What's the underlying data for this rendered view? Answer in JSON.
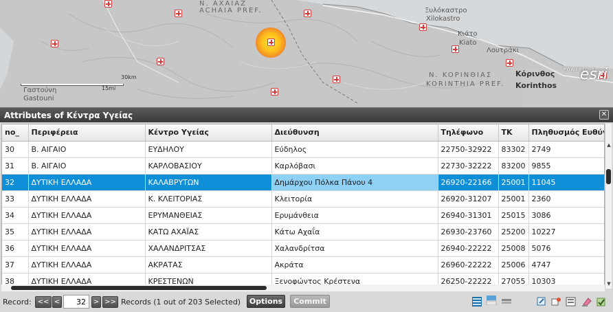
{
  "map": {
    "region_labels": [
      "N. AXAIAZ",
      "ACHAIA PREF.",
      "N. KOPINΘIAΣ",
      "KORINTHIA PREF."
    ],
    "city_labels": [
      "Ξυλόκαστρο",
      "Xilokastro",
      "Κιάτο",
      "Kiato",
      "Λουτράκι",
      "Κόρινθος",
      "Korinthos",
      "Γαστούνη",
      "Gastouni"
    ],
    "scale": {
      "km": "30km",
      "mi": "15mi"
    },
    "attribution": {
      "powered": "POWERED BY",
      "brand": "esri"
    }
  },
  "panel": {
    "title": "Attributes of Κέντρα Υγείας",
    "close_symbol": "✕"
  },
  "table": {
    "columns": [
      "no_",
      "Περιφέρεια",
      "Κέντρο Υγείας",
      "Διεύθυνση",
      "Τηλέφωνο",
      "ΤΚ",
      "Πληθυσμός Ευθύνης"
    ],
    "rows": [
      [
        "30",
        "Β. ΑΙΓΑΙΟ",
        "ΕΥΔΗΛΟΥ",
        "Εύδηλος",
        "22750-32922",
        "83302",
        "2749"
      ],
      [
        "31",
        "Β. ΑΙΓΑΙΟ",
        "ΚΑΡΛΟΒΑΣΙΟΥ",
        "Καρλόβασι",
        "22730-32222",
        "83200",
        "9855"
      ],
      [
        "32",
        "ΔΥΤΙΚΗ ΕΛΛΑΔΑ",
        "ΚΑΛΑΒΡΥΤΩΝ",
        "Δημάρχου Πόλκα Πάνου 4",
        "26920-22166",
        "25001",
        "11045"
      ],
      [
        "33",
        "ΔΥΤΙΚΗ ΕΛΛΑΔΑ",
        "Κ. ΚΛΕΙΤΟΡΙΑΣ",
        "Κλειτορία",
        "26920-31207",
        "25001",
        "2360"
      ],
      [
        "34",
        "ΔΥΤΙΚΗ ΕΛΛΑΔΑ",
        "ΕΡΥΜΑΝΘΕΙΑΣ",
        "Ερυμάνθεια",
        "26940-31301",
        "25015",
        "3086"
      ],
      [
        "35",
        "ΔΥΤΙΚΗ ΕΛΛΑΔΑ",
        "ΚΑΤΩ ΑΧΑΪΑΣ",
        "Κάτω Αχαΐα",
        "26930-23760",
        "25200",
        "10227"
      ],
      [
        "36",
        "ΔΥΤΙΚΗ ΕΛΛΑΔΑ",
        "ΧΑΛΑΝΔΡΙΤΣΑΣ",
        "Χαλανδρίτσα",
        "26940-22222",
        "25008",
        "5076"
      ],
      [
        "37",
        "ΔΥΤΙΚΗ ΕΛΛΑΔΑ",
        "ΑΚΡΑΤΑΣ",
        "Ακράτα",
        "26960-22222",
        "25006",
        "4747"
      ],
      [
        "38",
        "ΔΥΤΙΚΗ ΕΛΛΑΔΑ",
        "ΚΡΕΣΤΕΝΩΝ",
        "Ξενοφώντος Κρέστενα",
        "26250-22222",
        "27055",
        "10303"
      ]
    ],
    "selected_row": 2
  },
  "footer": {
    "record_label": "Record:",
    "first": "<<",
    "prev": "<",
    "current_record": "32",
    "next": ">",
    "last": ">>",
    "status": "Records (1 out of 203 Selected)",
    "options": "Options",
    "commit": "Commit"
  }
}
